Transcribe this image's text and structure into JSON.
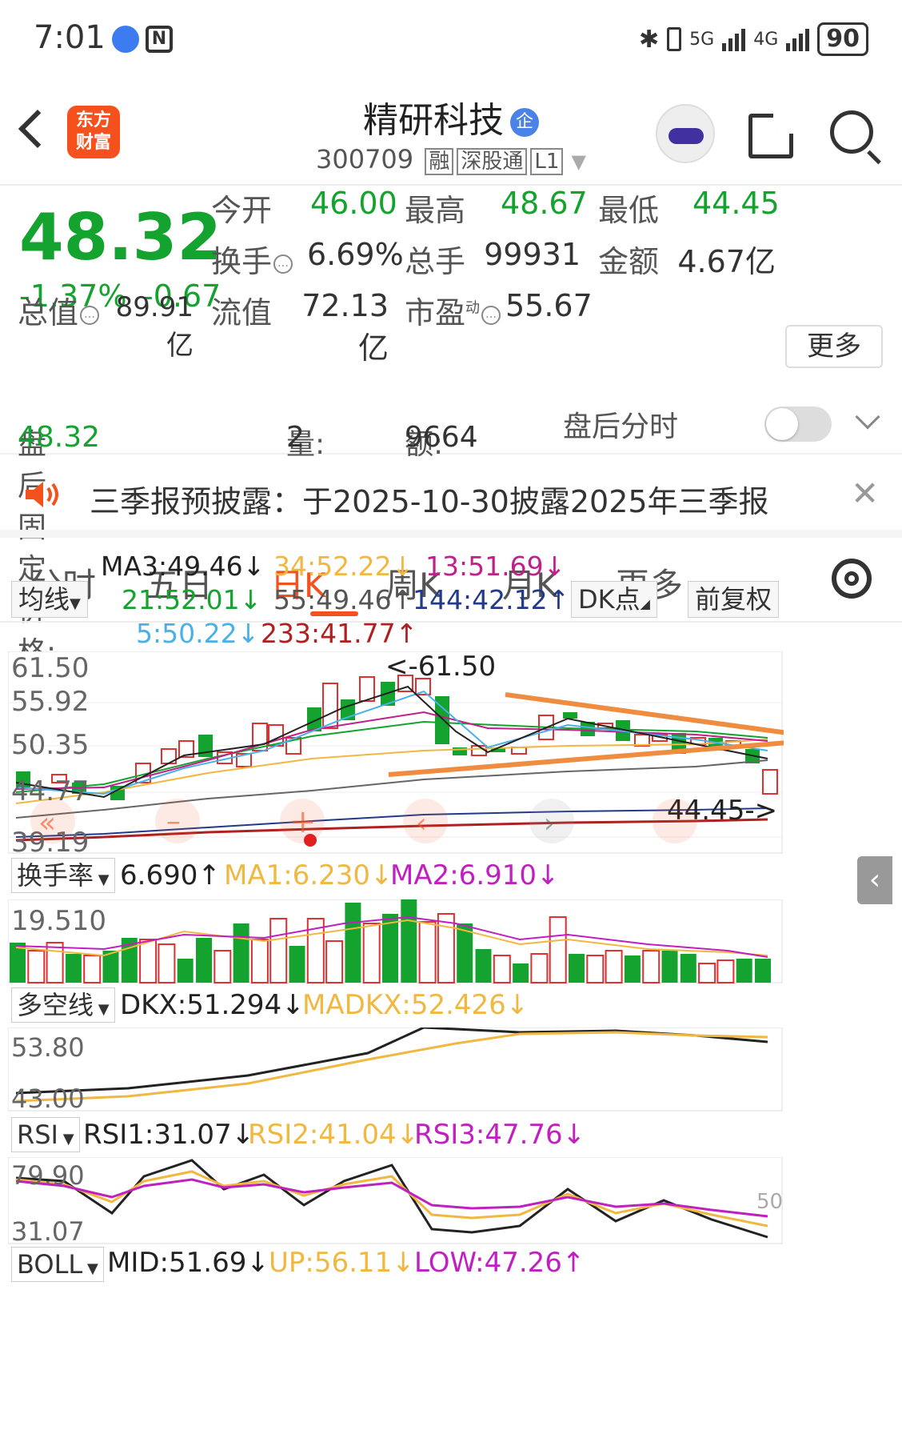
{
  "status_bar": {
    "time": "7:01",
    "net1": "5G",
    "net2": "4G",
    "battery": "90"
  },
  "nav": {
    "logo_top": "东方",
    "logo_bottom": "财富",
    "stock_name": "精研科技",
    "badge": "企",
    "code": "300709",
    "tags": [
      "融",
      "深股通",
      "L1"
    ]
  },
  "quote": {
    "price": "48.32",
    "change_pct": "-1.37%",
    "change": "-0.67",
    "open_label": "今开",
    "open": "46.00",
    "high_label": "最高",
    "high": "48.67",
    "low_label": "最低",
    "low": "44.45",
    "turnover_label": "换手",
    "turnover": "6.69%",
    "volume_label": "总手",
    "volume": "99931",
    "amount_label": "金额",
    "amount": "4.67亿",
    "mktcap_label": "总值",
    "mktcap": "89.91亿",
    "float_label": "流值",
    "float": "72.13亿",
    "pe_label": "市盈",
    "pe_sup": "动",
    "pe": "55.67",
    "more_label": "更多"
  },
  "after_hours": {
    "price_label": "盘后固定价格: ",
    "price": "48.32",
    "vol_label": "量: ",
    "vol": "2",
    "amt_label": "额: ",
    "amt": "9664",
    "toggle_label": "盘后分时"
  },
  "notice": {
    "text": "三季报预披露：于2025-10-30披露2025年三季报"
  },
  "tabs": [
    "分时",
    "五日",
    "日K",
    "周K",
    "月K",
    "更多"
  ],
  "active_tab": "日K",
  "ma_panel": {
    "selector": "均线",
    "ma3": "MA3:49.46↓",
    "ma34": "34:52.22↓",
    "ma13": "13:51.69↓",
    "ma21": "21:52.01↓",
    "ma55": "55:49.46↑",
    "ma144": "144:42.12↑",
    "ma5": "5:50.22↓",
    "ma233": "233:41.77↑",
    "dk_button": "DK点",
    "adjust_button": "前复权"
  },
  "kline": {
    "y_labels": [
      "61.50",
      "55.92",
      "50.35",
      "44.77",
      "39.19"
    ],
    "max_marker": "<-61.50",
    "min_marker": "44.45->"
  },
  "turnover_panel": {
    "selector": "换手率",
    "value": "6.690↑",
    "ma1": "MA1:6.230↓",
    "ma2": "MA2:6.910↓",
    "y_label": "19.510"
  },
  "dkx_panel": {
    "selector": "多空线",
    "dkx": "DKX:51.294↓",
    "madkx": "MADKX:52.426↓",
    "y_top": "53.80",
    "y_bottom": "43.00"
  },
  "rsi_panel": {
    "selector": "RSI",
    "rsi1": "RSI1:31.07↓",
    "rsi2": "RSI2:41.04↓",
    "rsi3": "RSI3:47.76↓",
    "y_top": "79.90",
    "y_bottom": "31.07",
    "mid": "50"
  },
  "boll_panel": {
    "selector": "BOLL",
    "mid": "MID:51.69↓",
    "up": "UP:56.11↓",
    "low": "LOW:47.26↑"
  },
  "colors": {
    "green": "#14a32e",
    "red": "#e03030",
    "accent": "#f4511e"
  }
}
